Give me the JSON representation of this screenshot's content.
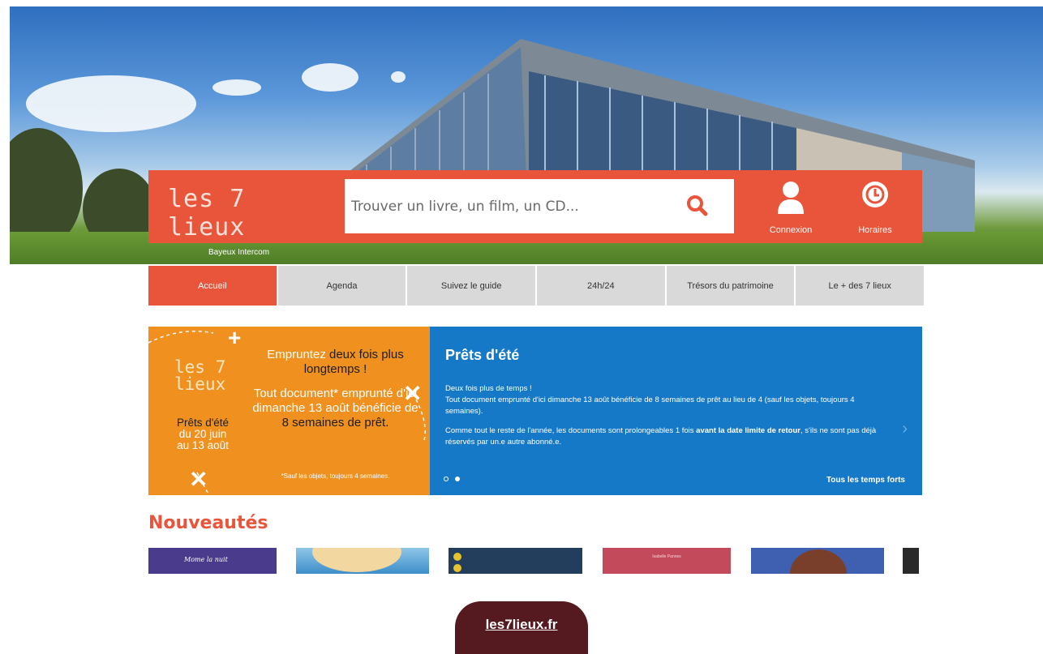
{
  "header": {
    "logo_text": "les 7 lieux",
    "logo_subtitle": "Bayeux Intercom",
    "search": {
      "placeholder": "Trouver un livre, un film, un CD..."
    },
    "connexion_label": "Connexion",
    "horaires_label": "Horaires"
  },
  "nav": {
    "items": [
      {
        "label": "Accueil",
        "active": true
      },
      {
        "label": "Agenda"
      },
      {
        "label": "Suivez le guide"
      },
      {
        "label": "24h/24"
      },
      {
        "label": "Trésors du patrimoine"
      },
      {
        "label": "Le + des 7 lieux"
      }
    ]
  },
  "promo": {
    "left": {
      "logo_line1": "les 7",
      "logo_line2": "lieux",
      "dates_line1": "Prêts d'été",
      "dates_line2": "du 20 juin",
      "dates_line3": "au 13 août",
      "main1_a": "Empruntez ",
      "main1_b": "deux fois plus longtemps !",
      "main2": "Tout document* emprunté d'ici dimanche 13 août bénéficie de",
      "main3": "8 semaines de prêt.",
      "note": "*Sauf les objets, toujours 4 semaines."
    },
    "right": {
      "title": "Prêts d'été",
      "p1": "Deux fois plus de temps !",
      "p2": "Tout document emprunté d'ici dimanche 13 août bénéficie de 8 semaines de prêt au lieu de 4 (sauf les objets, toujours 4 semaines).",
      "p3_a": "Comme tout le reste de l'année, les documents sont prolongeables 1 fois ",
      "p3_b": "avant la date limite de retour",
      "p3_c": ", s'ils ne sont pas déjà réservés par un.e autre abonné.e.",
      "link": "Tous les temps forts",
      "arrow": "›"
    }
  },
  "nouveautes": {
    "title": "Nouveautés",
    "cover_text": "Mome la nuit",
    "cover2_text": "Isabelle Pannes"
  },
  "footer": {
    "url": "les7lieux.fr"
  },
  "colors": {
    "brand": "#e8553a",
    "promo_orange": "#f0901f",
    "promo_blue": "#1679c8",
    "pill": "#551a1f"
  }
}
